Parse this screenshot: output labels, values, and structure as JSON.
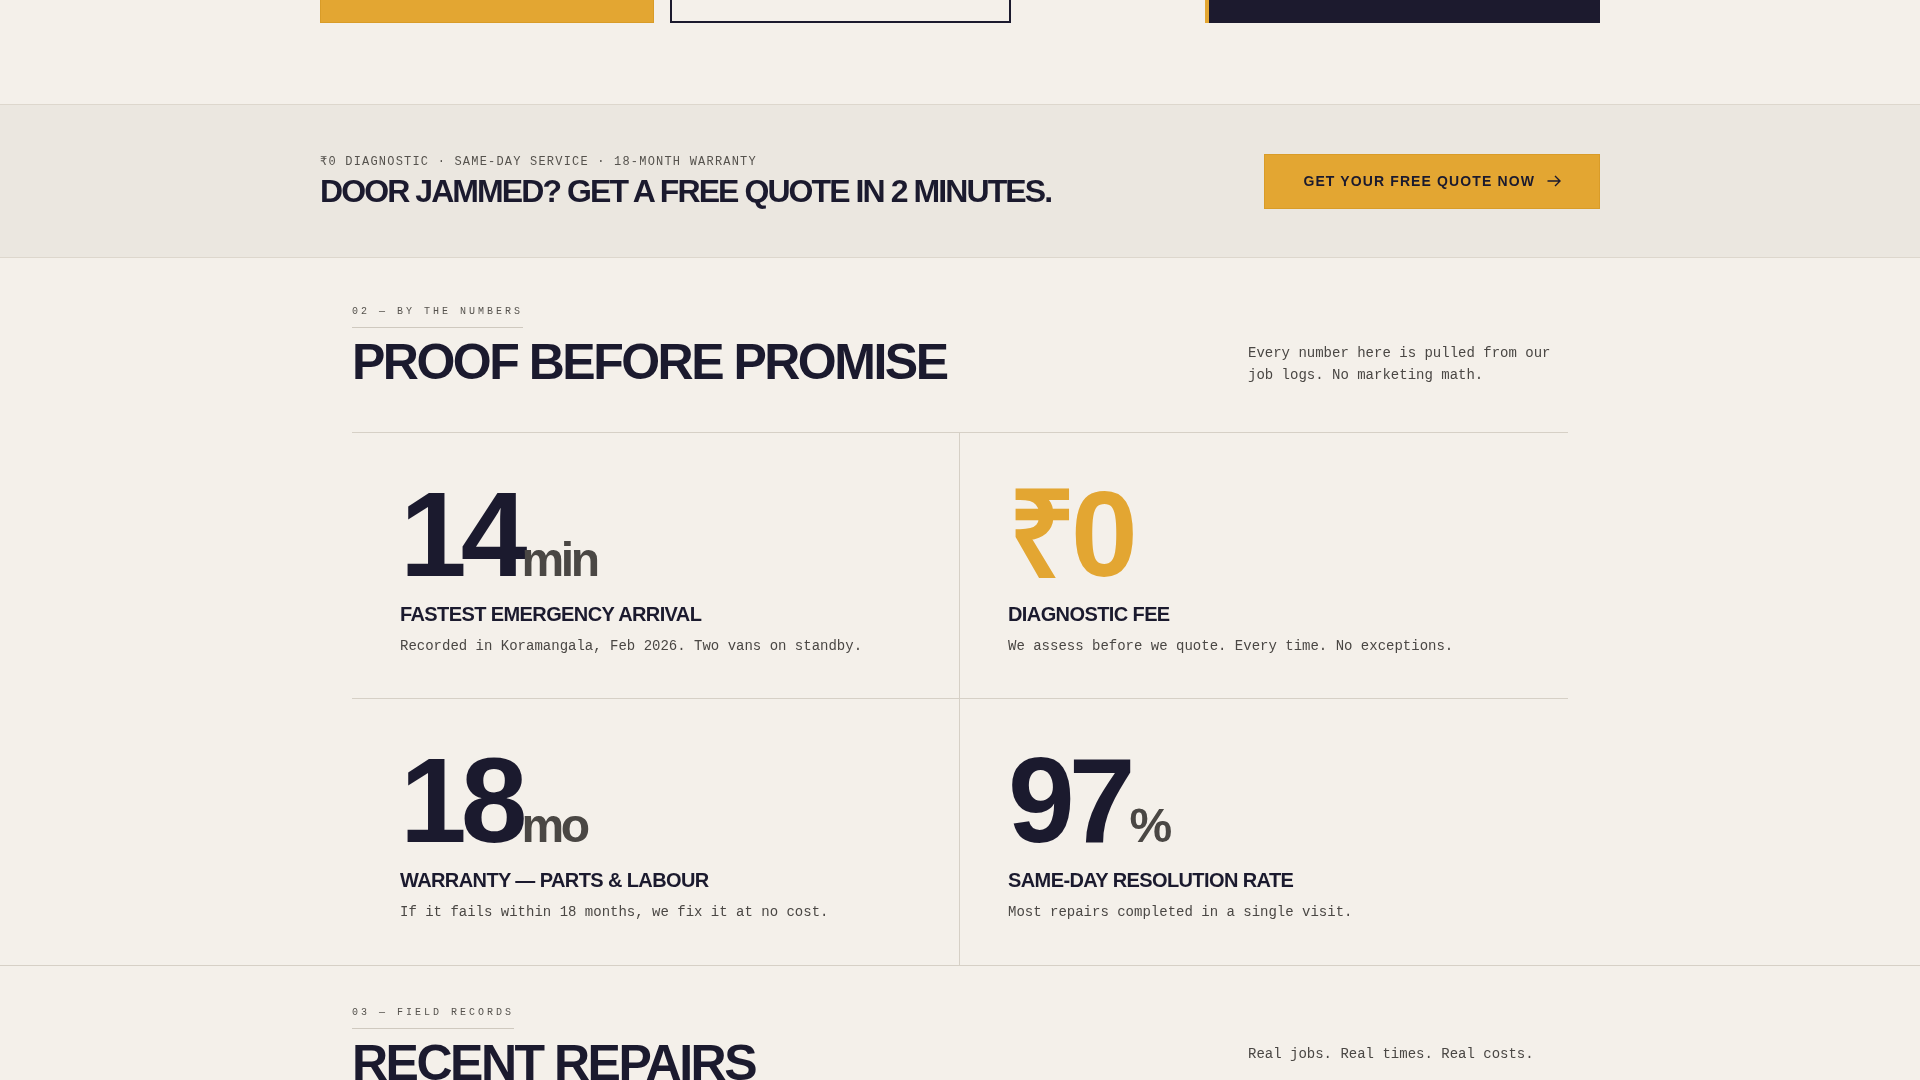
{
  "hero": {
    "buttons": [
      {
        "kind": "primary"
      },
      {
        "kind": "outline"
      }
    ]
  },
  "banner": {
    "eyebrow": "₹0 DIAGNOSTIC · SAME-DAY SERVICE · 18-MONTH WARRANTY",
    "headline": "DOOR JAMMED? GET A FREE QUOTE IN 2 MINUTES.",
    "button": "GET YOUR FREE QUOTE NOW"
  },
  "numbers_section": {
    "label": "02 — BY THE NUMBERS",
    "title": "PROOF BEFORE PROMISE",
    "intro": "Every number here is pulled from our job logs. No marketing math.",
    "stats": [
      {
        "value": "14",
        "unit": "min",
        "accent": false,
        "label": "FASTEST EMERGENCY ARRIVAL",
        "description": "Recorded in Koramangala, Feb 2026. Two vans on standby."
      },
      {
        "value": "₹0",
        "accent": true,
        "label": "DIAGNOSTIC FEE",
        "description": "We assess before we quote. Every time. No exceptions."
      },
      {
        "value": "18",
        "unit": "mo",
        "accent": false,
        "label": "WARRANTY — PARTS & LABOUR",
        "description": "If it fails within 18 months, we fix it at no cost."
      },
      {
        "value": "97",
        "unit": "%",
        "accent": false,
        "label": "SAME-DAY RESOLUTION RATE",
        "description": "Most repairs completed in a single visit."
      }
    ]
  },
  "repairs_section": {
    "label": "03 — FIELD RECORDS",
    "title": "RECENT REPAIRS",
    "intro": "Real jobs. Real times. Real costs."
  }
}
